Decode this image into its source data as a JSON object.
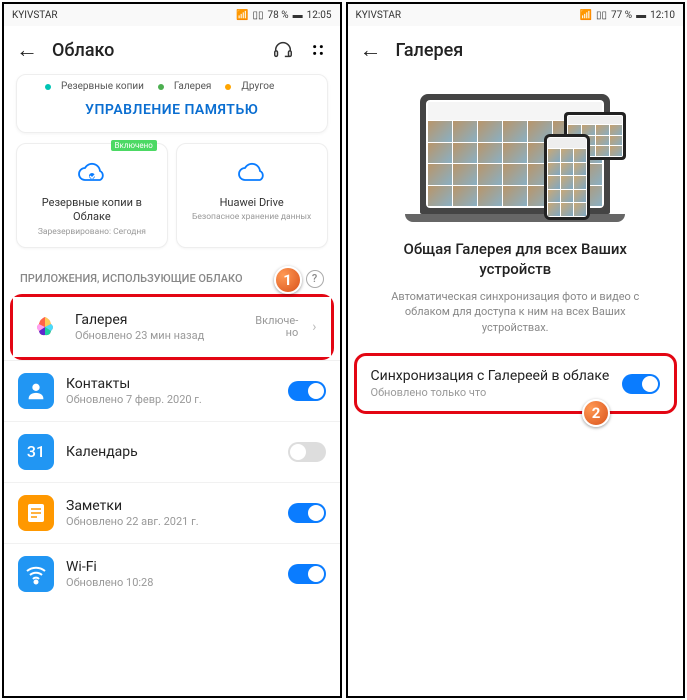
{
  "left": {
    "status": {
      "carrier": "KYIVSTAR",
      "battery": "78 %",
      "time": "12:05"
    },
    "header": {
      "title": "Облако"
    },
    "legend": {
      "backup": "Резервные копии",
      "gallery": "Галерея",
      "other": "Другое"
    },
    "manage": "УПРАВЛЕНИЕ ПАМЯТЬЮ",
    "cards": {
      "backup": {
        "badge": "Включено",
        "title": "Резервные копии в Облаке",
        "sub": "Зарезервировано: Сегодня"
      },
      "drive": {
        "title": "Huawei Drive",
        "sub": "Безопасное хранение данных"
      }
    },
    "section": "ПРИЛОЖЕНИЯ, ИСПОЛЬЗУЮЩИЕ ОБЛАКО",
    "items": {
      "gallery": {
        "title": "Галерея",
        "sub": "Обновлено 23 мин назад",
        "status": "Включе-\nно"
      },
      "contacts": {
        "title": "Контакты",
        "sub": "Обновлено 7 февр. 2020 г."
      },
      "calendar": {
        "title": "Календарь",
        "sub": ""
      },
      "notes": {
        "title": "Заметки",
        "sub": "Обновлено 22 авг. 2021 г."
      },
      "wifi": {
        "title": "Wi-Fi",
        "sub": "Обновлено 10:28"
      }
    }
  },
  "right": {
    "status": {
      "carrier": "KYIVSTAR",
      "battery": "77 %",
      "time": "12:10"
    },
    "header": {
      "title": "Галерея"
    },
    "hero": {
      "title": "Общая Галерея для всех Ваших устройств",
      "sub": "Автоматическая синхронизация фото и видео с облаком для доступа к ним на всех Ваших устройствах."
    },
    "sync": {
      "title": "Синхронизация с Галереей в облаке",
      "sub": "Обновлено только что"
    }
  },
  "steps": {
    "one": "1",
    "two": "2"
  }
}
